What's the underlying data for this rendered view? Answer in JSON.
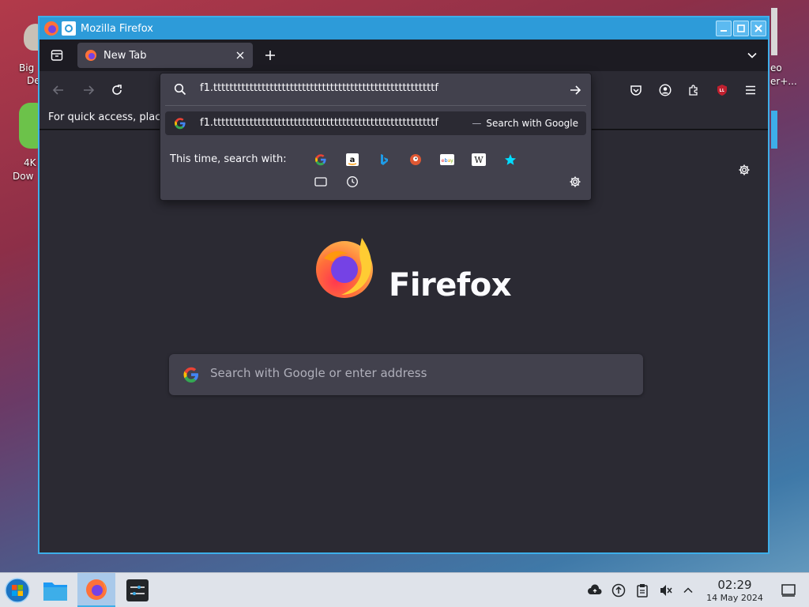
{
  "window": {
    "title": "Mozilla Firefox"
  },
  "tab": {
    "label": "New Tab"
  },
  "bookmarks": {
    "text": "For quick access, plac"
  },
  "urlbar": {
    "value": "f1.tttttttttttttttttttttttttttttttttttttttttttttttttttttttf"
  },
  "suggestion": {
    "query": "f1.tttttttttttttttttttttttttttttttttttttttttttttttttttttttf",
    "dash": "—",
    "action": "Search with Google"
  },
  "one_off": {
    "label": "This time, search with:",
    "engines": [
      "google-icon",
      "amazon-icon",
      "bing-icon",
      "duckduckgo-icon",
      "ebay-icon",
      "wikipedia-icon",
      "bookmarks-star-icon",
      "tabs-icon",
      "history-icon"
    ]
  },
  "newtab": {
    "brand": "Firefox",
    "search_placeholder": "Search with Google or enter address"
  },
  "desktop": {
    "labels": [
      "Big",
      "De",
      "4K",
      "Dow",
      "eo",
      "er+..."
    ]
  },
  "taskbar": {
    "time": "02:29",
    "date": "14 May 2024"
  },
  "colors": {
    "accent": "#3daee9",
    "firefox_orange": "#ff7139",
    "firefox_purple": "#7542e5"
  }
}
